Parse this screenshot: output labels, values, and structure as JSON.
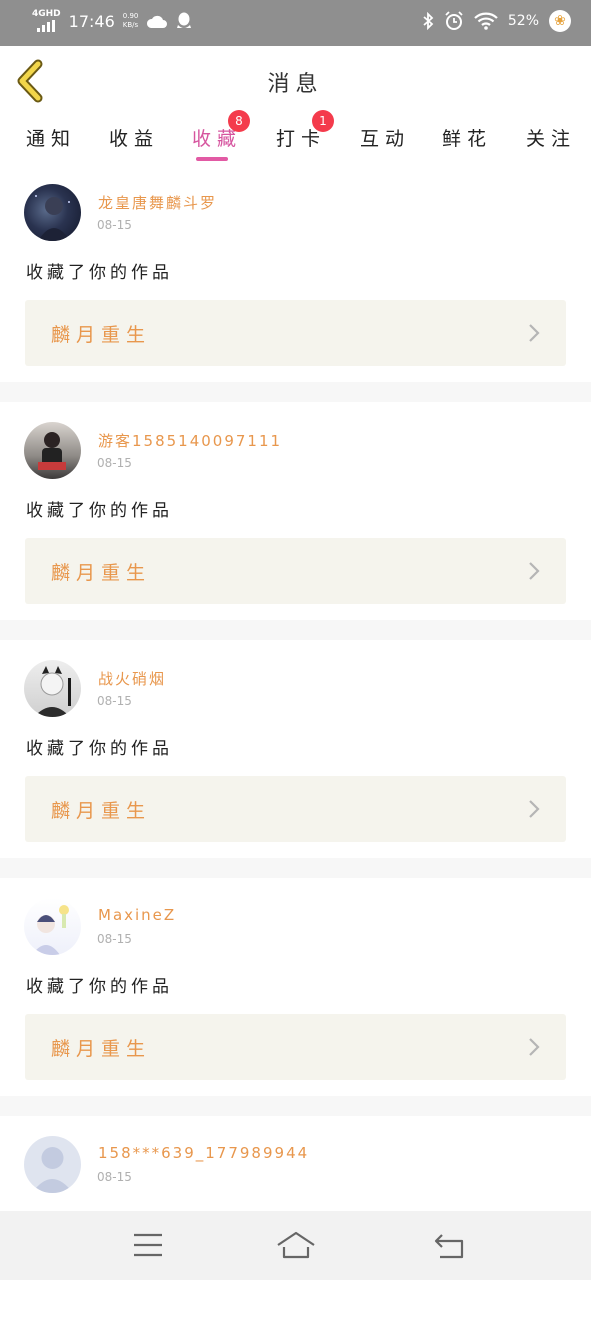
{
  "status_bar": {
    "network": "4GHD",
    "time": "17:46",
    "speed_value": "0.90",
    "speed_unit": "KB/s",
    "battery": "52%"
  },
  "header": {
    "title": "消息"
  },
  "tabs": [
    {
      "label": "通知",
      "active": false,
      "badge": ""
    },
    {
      "label": "收益",
      "active": false,
      "badge": ""
    },
    {
      "label": "收藏",
      "active": true,
      "badge": "8"
    },
    {
      "label": "打卡",
      "active": false,
      "badge": "1"
    },
    {
      "label": "互动",
      "active": false,
      "badge": ""
    },
    {
      "label": "鲜花",
      "active": false,
      "badge": ""
    },
    {
      "label": "关注",
      "active": false,
      "badge": ""
    }
  ],
  "messages": [
    {
      "username": "龙皇唐舞麟斗罗",
      "date": "08-15",
      "action": "收藏了你的作品",
      "work_title": "麟月重生"
    },
    {
      "username": "游客1585140097111",
      "date": "08-15",
      "action": "收藏了你的作品",
      "work_title": "麟月重生"
    },
    {
      "username": "战火硝烟",
      "date": "08-15",
      "action": "收藏了你的作品",
      "work_title": "麟月重生"
    },
    {
      "username": "MaxineZ",
      "date": "08-15",
      "action": "收藏了你的作品",
      "work_title": "麟月重生"
    },
    {
      "username": "158***639_177989944",
      "date": "08-15",
      "action": "",
      "work_title": ""
    }
  ],
  "colors": {
    "accent_pink": "#e25aa4",
    "username_orange": "#e8974d",
    "badge_red": "#f43b4c",
    "card_bg": "#f5f4ed"
  }
}
